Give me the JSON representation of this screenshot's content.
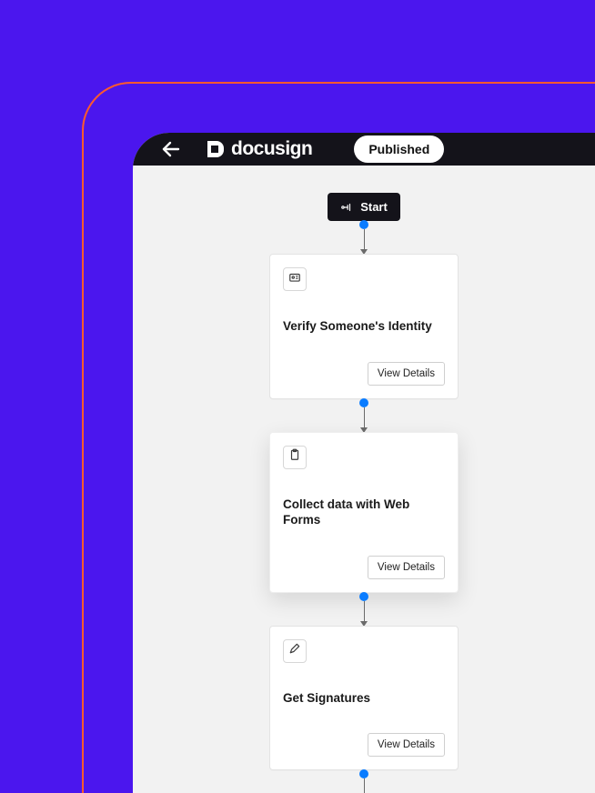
{
  "header": {
    "brand": "docusign",
    "status_label": "Published"
  },
  "flow": {
    "start_label": "Start",
    "nodes": [
      {
        "icon": "id-card-icon",
        "title": "Verify Someone's Identity",
        "action_label": "View Details",
        "elevated": false
      },
      {
        "icon": "clipboard-icon",
        "title": "Collect data with Web Forms",
        "action_label": "View Details",
        "elevated": true
      },
      {
        "icon": "pen-icon",
        "title": "Get Signatures",
        "action_label": "View Details",
        "elevated": false
      }
    ]
  }
}
